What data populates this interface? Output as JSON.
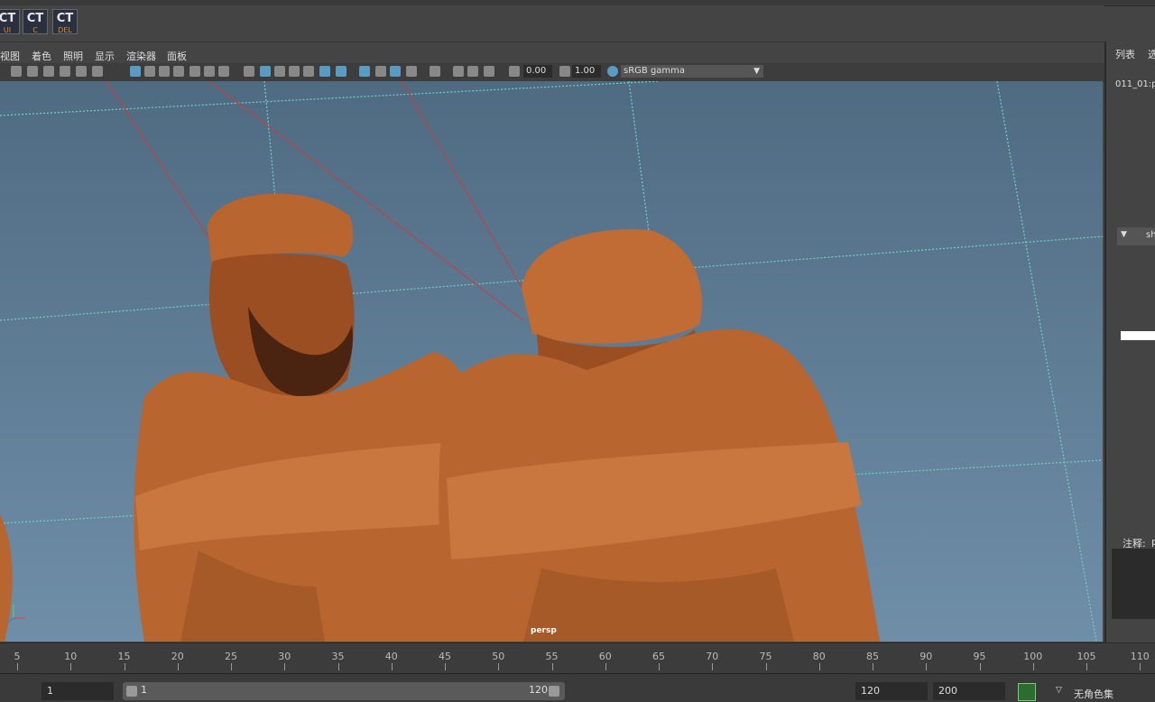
{
  "shelf": {
    "buttons": [
      {
        "big": "CT",
        "small": "UI",
        "small_color": "#e08a2e"
      },
      {
        "big": "CT",
        "small": "C",
        "small_color": "#e08a2e"
      },
      {
        "big": "CT",
        "small": "DEL",
        "small_color": "#e08a2e"
      }
    ]
  },
  "panel_menu": [
    "视图",
    "着色",
    "照明",
    "显示",
    "渲染器",
    "面板"
  ],
  "toolbar": {
    "exposure": "0.00",
    "gamma": "1.00",
    "color_space": "sRGB gamma"
  },
  "viewport": {
    "camera": "persp"
  },
  "side_panel": {
    "tab_list": "列表",
    "tab_select": "选",
    "item_name": "011_01:p",
    "section": "sh",
    "notes_label": "注释:",
    "notes_value": "p"
  },
  "timeline": {
    "ticks": [
      5,
      10,
      15,
      20,
      25,
      30,
      35,
      40,
      45,
      50,
      55,
      60,
      65,
      70,
      75,
      80,
      85,
      90,
      95,
      100,
      105,
      110
    ]
  },
  "range": {
    "start": "1",
    "slider_start": "1",
    "slider_end": "120",
    "end": "120",
    "anim_end": "200",
    "character_set": "无角色集"
  },
  "colors": {
    "accent": "#5a9bc4",
    "sculpture": "#b8652f",
    "grid": "#6fd3c0"
  }
}
